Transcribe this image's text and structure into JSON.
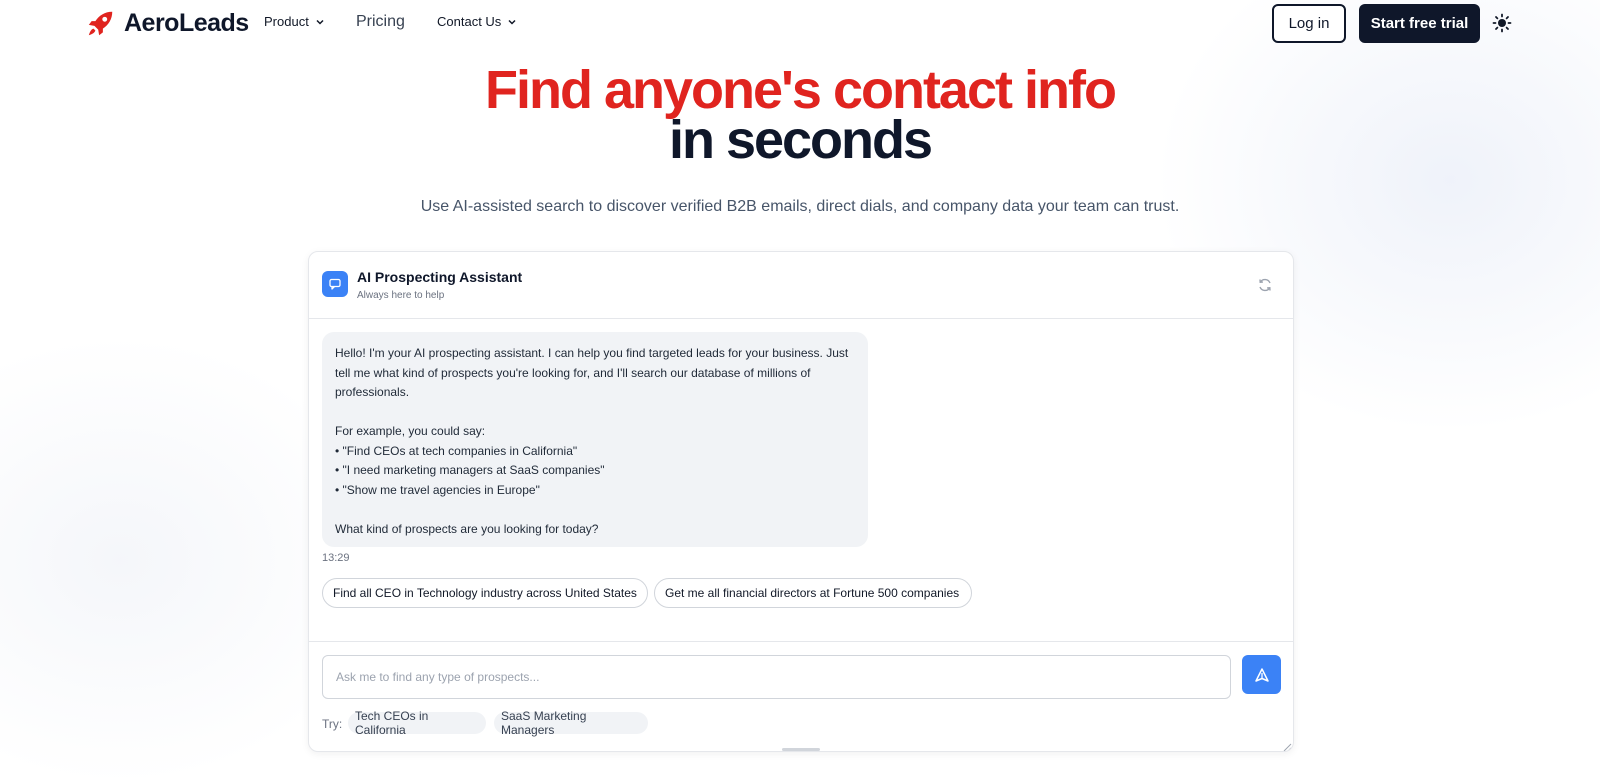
{
  "colors": {
    "brand_red": "#e0241f",
    "dark": "#0f172a",
    "accent_blue": "#3b82f6"
  },
  "nav": {
    "logo_text": "AeroLeads",
    "logo_icon": "rocket-icon",
    "items": [
      {
        "label": "Product",
        "has_dropdown": true
      },
      {
        "label": "Pricing",
        "has_dropdown": false
      },
      {
        "label": "Contact Us",
        "has_dropdown": true
      }
    ],
    "login_label": "Log in",
    "trial_label": "Start free trial",
    "theme_icon": "sun-icon"
  },
  "hero": {
    "line1": "Find anyone's contact info",
    "line2": "in seconds",
    "subtitle": "Use AI-assisted search to discover verified B2B emails, direct dials, and company data your team can trust."
  },
  "chat": {
    "title": "AI Prospecting Assistant",
    "subtitle": "Always here to help",
    "assistant_icon": "chat-bubble-icon",
    "refresh_icon": "refresh-icon",
    "message": {
      "paragraphs": [
        "Hello! I'm your AI prospecting assistant. I can help you find targeted leads for your business. Just tell me what kind of prospects you're looking for, and I'll search our database of millions of professionals.",
        "For example, you could say:\n• \"Find CEOs at tech companies in California\"\n• \"I need marketing managers at SaaS companies\"\n• \"Show me travel agencies in Europe\"",
        "What kind of prospects are you looking for today?"
      ],
      "time": "13:29"
    },
    "suggestions": [
      "Find all CEO in Technology industry across United States",
      "Get me all financial directors at Fortune 500 companies"
    ],
    "input": {
      "placeholder": "Ask me to find any type of prospects...",
      "value": ""
    },
    "send_icon": "send-icon",
    "try_label": "Try:",
    "try_chips": [
      "Tech CEOs in California",
      "SaaS Marketing Managers"
    ]
  }
}
